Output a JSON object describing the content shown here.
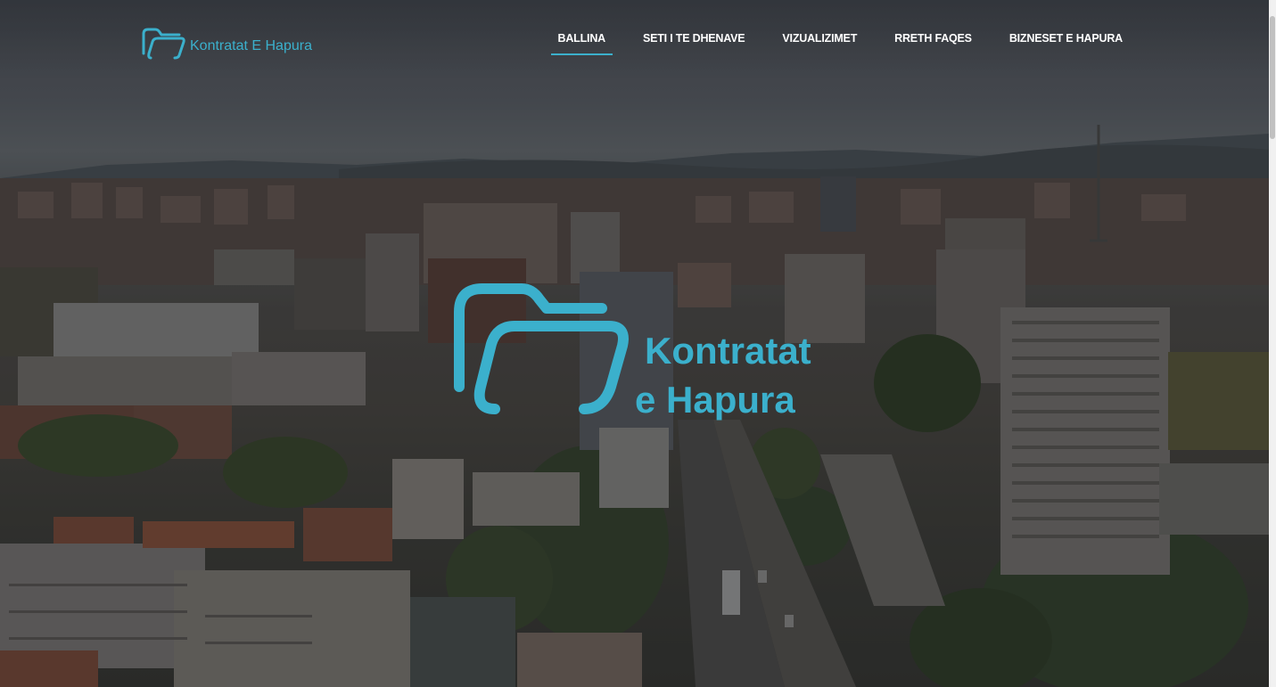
{
  "header": {
    "brand_name": "Kontratat E Hapura",
    "nav": [
      {
        "label": "BALLINA",
        "active": true
      },
      {
        "label": "SETI I TE DHENAVE",
        "active": false
      },
      {
        "label": "VIZUALIZIMET",
        "active": false
      },
      {
        "label": "RRETH FAQES",
        "active": false
      },
      {
        "label": "BIZNESET E HAPURA",
        "active": false
      }
    ]
  },
  "hero": {
    "title_line1": "Kontratat",
    "title_line2": "e Hapura",
    "background": "city-aerial-photo"
  },
  "colors": {
    "accent": "#3bb0cc",
    "nav_text": "#ffffff"
  },
  "icons": {
    "brand": "folder-outline-icon",
    "hero": "folder-outline-icon"
  }
}
